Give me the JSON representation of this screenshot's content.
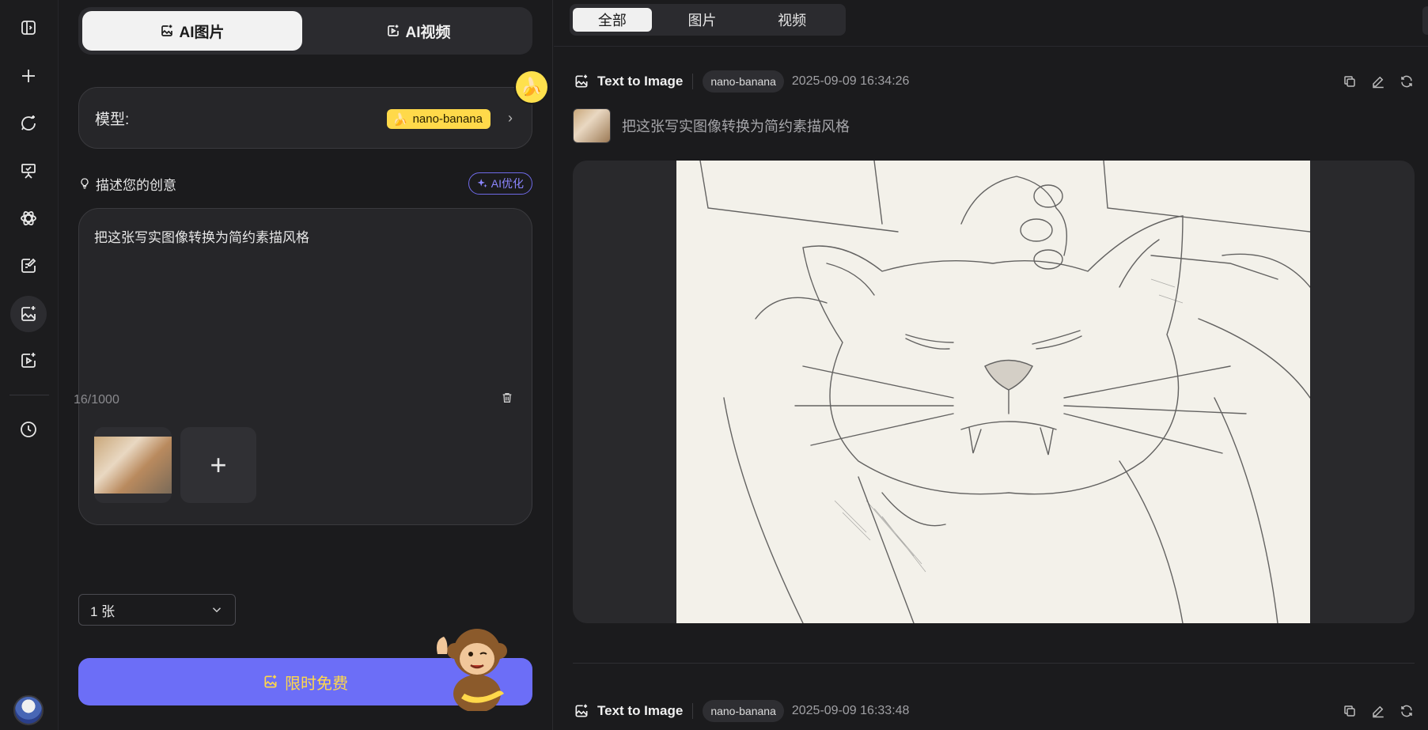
{
  "rail": {
    "items": [
      {
        "name": "sidebar-toggle",
        "icon": "panel-icon"
      },
      {
        "name": "new",
        "icon": "plus-icon"
      },
      {
        "name": "ai-chat",
        "icon": "chat-sparkle-icon"
      },
      {
        "name": "presentation",
        "icon": "presentation-icon"
      },
      {
        "name": "ai-model",
        "icon": "atom-icon"
      },
      {
        "name": "ai-writing",
        "icon": "edit-doc-icon"
      },
      {
        "name": "ai-image",
        "icon": "image-sparkle-icon",
        "active": true
      },
      {
        "name": "ai-video",
        "icon": "video-sparkle-icon"
      },
      {
        "name": "history",
        "icon": "clock-icon"
      }
    ]
  },
  "panel": {
    "tabs": [
      {
        "label": "AI图片",
        "active": true
      },
      {
        "label": "AI视频",
        "active": false
      }
    ],
    "model": {
      "label": "模型:",
      "value": "nano-banana"
    },
    "idea": {
      "title": "描述您的创意",
      "optimize_label": "AI优化"
    },
    "prompt": {
      "text": "把这张写实图像转换为简约素描风格",
      "counter": "16/1000"
    },
    "count": {
      "value": "1 张"
    },
    "generate_label": "限时免费"
  },
  "main": {
    "filter_tabs": [
      {
        "label": "全部",
        "active": true
      },
      {
        "label": "图片",
        "active": false
      },
      {
        "label": "视频",
        "active": false
      }
    ],
    "generations": [
      {
        "type": "Text to Image",
        "model": "nano-banana",
        "time": "2025-09-09 16:34:26",
        "prompt": "把这张写实图像转换为简约素描风格"
      },
      {
        "type": "Text to Image",
        "model": "nano-banana",
        "time": "2025-09-09 16:33:48"
      }
    ]
  },
  "colors": {
    "accent": "#6c6ef7",
    "banana": "#ffd94a",
    "background": "#1b1b1d"
  }
}
